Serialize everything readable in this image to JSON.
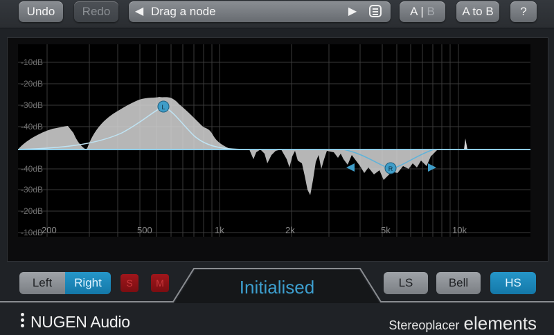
{
  "toolbar": {
    "undo": "Undo",
    "redo": "Redo",
    "preset_prev": "◀",
    "preset_label": "Drag a node",
    "preset_next": "▶",
    "ab_a": "A",
    "ab_sep": "|",
    "ab_b": "B",
    "a_to_b": "A to B",
    "help": "?"
  },
  "graph": {
    "db_labels_upper": [
      "-10dB",
      "-20dB",
      "-30dB",
      "-40dB"
    ],
    "db_labels_lower": [
      "-40dB",
      "-30dB",
      "-20dB",
      "-10dB"
    ],
    "freq_labels": [
      "200",
      "500",
      "1k",
      "2k",
      "5k",
      "10k"
    ],
    "node_left": "L",
    "node_right": "R",
    "colors": {
      "node": "#3f9dc8",
      "curve": "#8ecbe6",
      "spectrum": "#d9d9d9"
    }
  },
  "controls": {
    "left": "Left",
    "right": "Right",
    "solo": "S",
    "mute": "M",
    "status": "Initialised",
    "ls": "LS",
    "bell": "Bell",
    "hs": "HS"
  },
  "footer": {
    "brand": "NUGEN Audio",
    "product_prefix": "Stereoplacer",
    "product_suffix": "elements"
  }
}
